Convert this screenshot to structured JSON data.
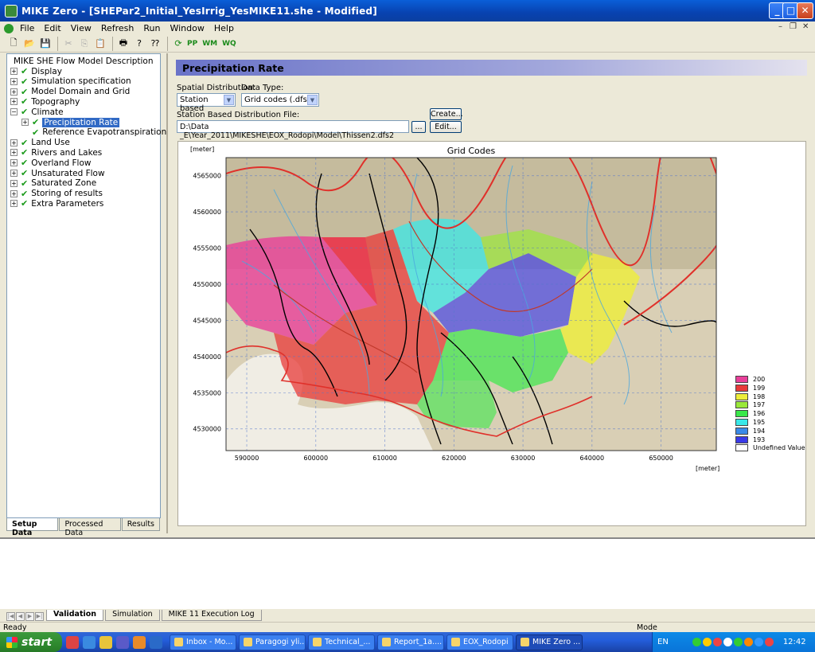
{
  "window": {
    "title": "MIKE Zero - [SHEPar2_Initial_YesIrrig_YesMIKE11.she - Modified]"
  },
  "menu": [
    "File",
    "Edit",
    "View",
    "Refresh",
    "Run",
    "Window",
    "Help"
  ],
  "toolbar": {
    "pp": "PP",
    "wm": "WM",
    "wq": "WQ"
  },
  "tree": {
    "root": "MIKE SHE Flow Model Description",
    "items": [
      {
        "label": "Display",
        "expander": "+"
      },
      {
        "label": "Simulation specification",
        "expander": "+"
      },
      {
        "label": "Model Domain and Grid",
        "expander": "+"
      },
      {
        "label": "Topography",
        "expander": "+"
      },
      {
        "label": "Climate",
        "expander": "−"
      },
      {
        "label": "Precipitation Rate",
        "expander": "+"
      },
      {
        "label": "Reference Evapotranspiration",
        "expander": ""
      },
      {
        "label": "Land Use",
        "expander": "+"
      },
      {
        "label": "Rivers and Lakes",
        "expander": "+"
      },
      {
        "label": "Overland Flow",
        "expander": "+"
      },
      {
        "label": "Unsaturated Flow",
        "expander": "+"
      },
      {
        "label": "Saturated Zone",
        "expander": "+"
      },
      {
        "label": "Storing of results",
        "expander": "+"
      },
      {
        "label": "Extra Parameters",
        "expander": "+"
      }
    ]
  },
  "left_tabs": [
    "Setup Data",
    "Processed Data",
    "Results"
  ],
  "panel": {
    "title": "Precipitation Rate",
    "spatial_label": "Spatial Distribution:",
    "spatial_value": "Station based",
    "datatype_label": "Data Type:",
    "datatype_value": "Grid codes (.dfs2)",
    "file_label": "Station Based Distribution File:",
    "file_value": "D:\\Data _E\\Year_2011\\MIKESHE\\EOX_Rodopi\\Model\\Thissen2.dfs2",
    "browse": "...",
    "create": "Create...",
    "edit": "Edit..."
  },
  "chart_data": {
    "type": "heatmap",
    "title": "Grid Codes",
    "xlabel": "[meter]",
    "ylabel": "[meter]",
    "xlim": [
      587000,
      658000
    ],
    "ylim": [
      4527000,
      4567500
    ],
    "xticks": [
      590000,
      600000,
      610000,
      620000,
      630000,
      640000,
      650000
    ],
    "yticks": [
      4530000,
      4535000,
      4540000,
      4545000,
      4550000,
      4555000,
      4560000,
      4565000
    ],
    "xtick_labels": [
      "590000",
      "600000",
      "610000",
      "620000",
      "630000",
      "640000",
      "650000"
    ],
    "ytick_labels": [
      "4530000",
      "4535000",
      "4540000",
      "4545000",
      "4550000",
      "4555000",
      "4560000",
      "4565000"
    ],
    "legend": [
      {
        "label": "200",
        "color": "#e8409a"
      },
      {
        "label": "199",
        "color": "#e83a3a"
      },
      {
        "label": "198",
        "color": "#eded3a"
      },
      {
        "label": "197",
        "color": "#9ae83a"
      },
      {
        "label": "196",
        "color": "#3ae84a"
      },
      {
        "label": "195",
        "color": "#3ae8e8"
      },
      {
        "label": "194",
        "color": "#3a8ae8"
      },
      {
        "label": "193",
        "color": "#3a3ae8"
      },
      {
        "label": "Undefined Value",
        "color": "#ffffff"
      }
    ]
  },
  "bottom_tabs": [
    "Validation",
    "Simulation",
    "MIKE 11 Execution Log"
  ],
  "status": {
    "left": "Ready",
    "mid": "Mode"
  },
  "taskbar": {
    "start": "start",
    "tasks": [
      "Inbox - Mo...",
      "Paragogi yli...",
      "Technical_...",
      "Report_1a....",
      "EOX_Rodopi",
      "MIKE Zero ..."
    ],
    "lang": "EN",
    "clock": "12:42"
  }
}
